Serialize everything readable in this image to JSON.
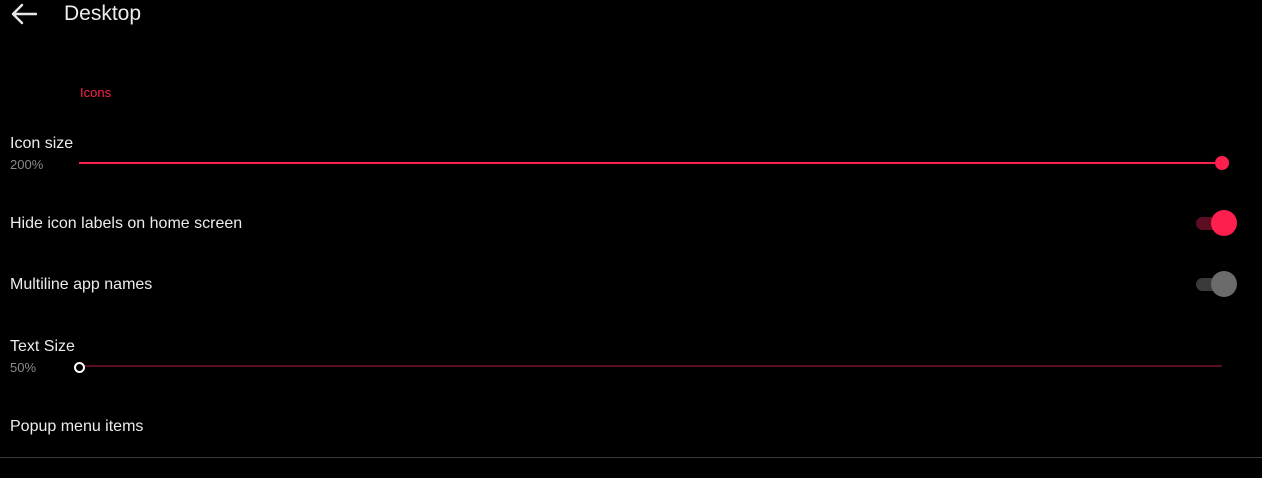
{
  "header": {
    "title": "Desktop",
    "back_icon": "arrow-left-icon"
  },
  "section": {
    "header": "Icons"
  },
  "icon_size": {
    "title": "Icon size",
    "value_label": "200%",
    "slider_fraction": 1.0
  },
  "hide_labels": {
    "title": "Hide icon labels on home screen",
    "checked": true
  },
  "multiline": {
    "title": "Multiline app names",
    "checked": false
  },
  "text_size": {
    "title": "Text Size",
    "value_label": "50%",
    "slider_fraction": 0.0
  },
  "popup": {
    "title": "Popup menu items"
  },
  "colors": {
    "accent": "#ff1f4f",
    "background": "#000000",
    "switch_off_thumb": "#6b6b6b"
  }
}
